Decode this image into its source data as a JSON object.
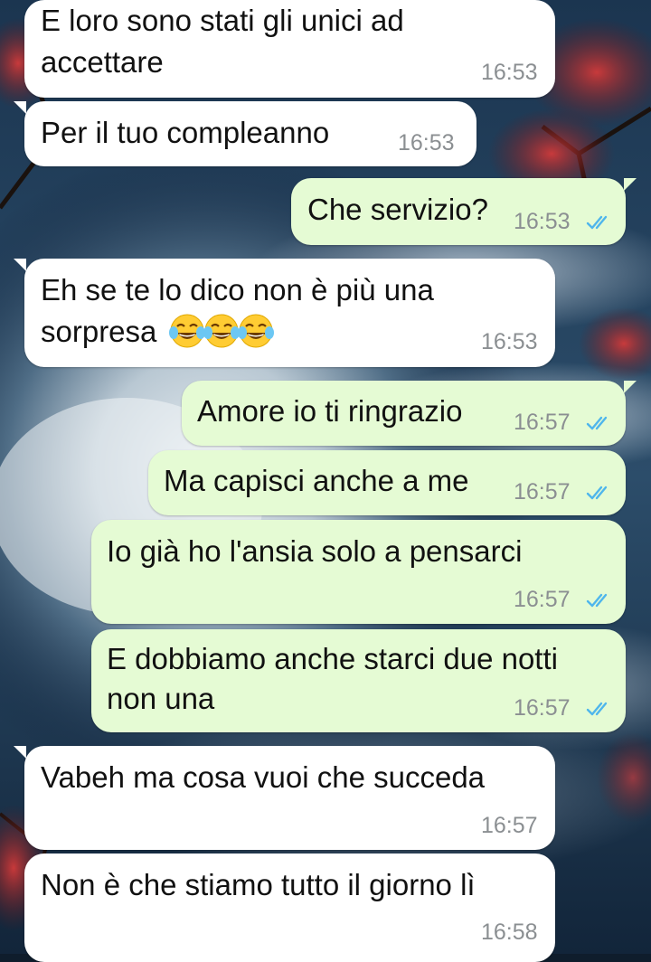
{
  "colors": {
    "incoming_bubble": "#ffffff",
    "outgoing_bubble": "#e5fbd4",
    "time_text": "#8b8f92",
    "read_ticks": "#4fb6ec"
  },
  "wallpaper": {
    "description_icon": "night-sky-moon-wallpaper"
  },
  "messages": [
    {
      "dir": "in",
      "lines": [
        "E loro sono stati gli unici ad",
        "accettare"
      ],
      "time": "16:53"
    },
    {
      "dir": "in",
      "lines": [
        "Per il tuo compleanno"
      ],
      "time": "16:53"
    },
    {
      "dir": "out",
      "lines": [
        "Che servizio?"
      ],
      "time": "16:53",
      "status": "read"
    },
    {
      "dir": "in",
      "lines": [
        "Eh se te lo dico non è più una",
        "sorpresa"
      ],
      "emoji": [
        "face-with-tears-of-joy",
        "face-with-tears-of-joy",
        "face-with-tears-of-joy"
      ],
      "time": "16:53"
    },
    {
      "dir": "out",
      "lines": [
        "Amore io ti ringrazio"
      ],
      "time": "16:57",
      "status": "read"
    },
    {
      "dir": "out",
      "lines": [
        "Ma capisci anche a me"
      ],
      "time": "16:57",
      "status": "read"
    },
    {
      "dir": "out",
      "lines": [
        "Io già ho l'ansia solo a pensarci"
      ],
      "time": "16:57",
      "status": "read"
    },
    {
      "dir": "out",
      "lines": [
        "E dobbiamo anche starci due notti",
        "non una"
      ],
      "time": "16:57",
      "status": "read"
    },
    {
      "dir": "in",
      "lines": [
        "Vabeh ma cosa vuoi che succeda"
      ],
      "time": "16:57"
    },
    {
      "dir": "in",
      "lines": [
        "Non è che stiamo tutto il giorno lì"
      ],
      "time": "16:58"
    }
  ]
}
